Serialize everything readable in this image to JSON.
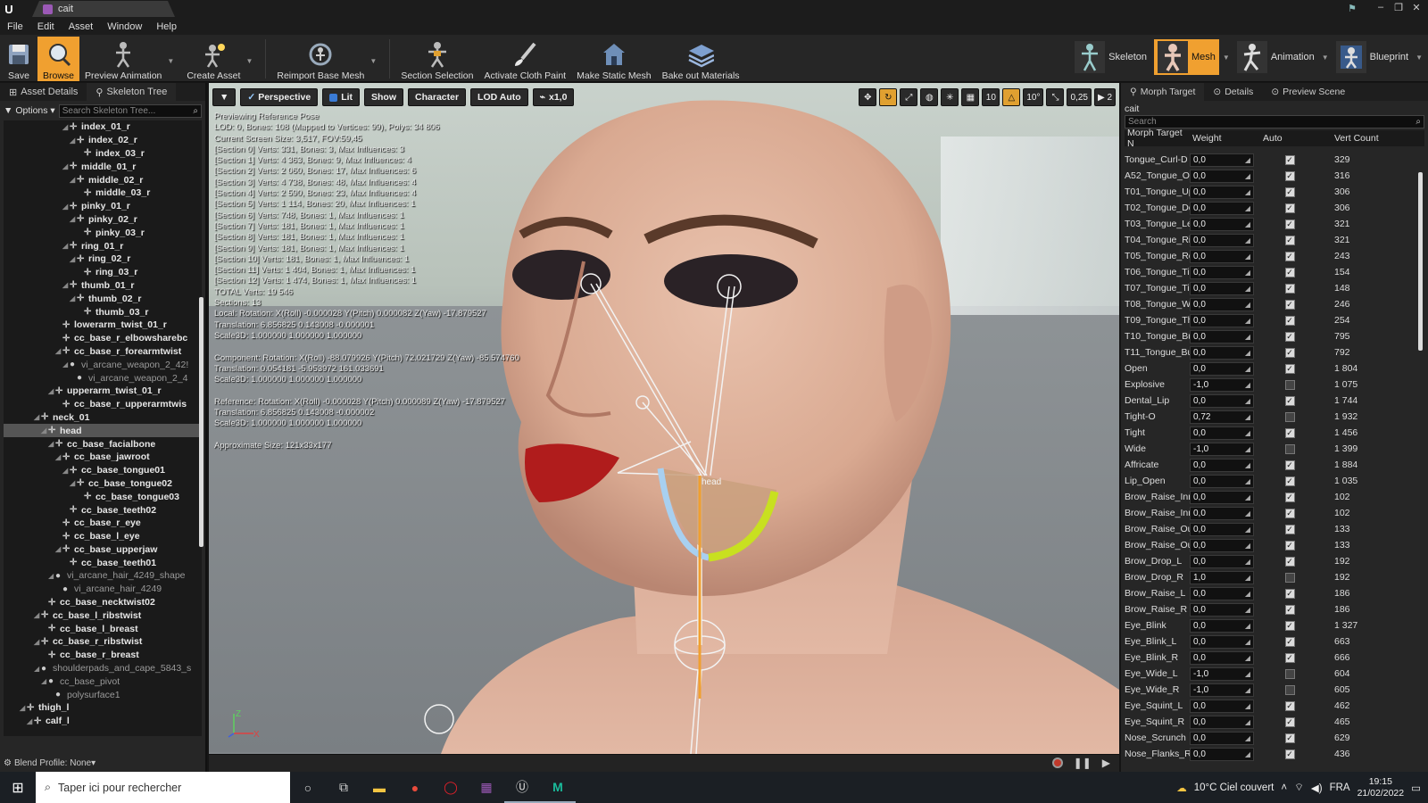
{
  "window": {
    "title": "cait"
  },
  "menu": [
    "File",
    "Edit",
    "Asset",
    "Window",
    "Help"
  ],
  "toolbar": {
    "buttons": [
      "Save",
      "Browse",
      "Preview Animation",
      "Create Asset",
      "Reimport Base Mesh",
      "Section Selection",
      "Activate Cloth Paint",
      "Make Static Mesh",
      "Bake out Materials"
    ],
    "modes": [
      "Skeleton",
      "Mesh",
      "Animation",
      "Blueprint"
    ]
  },
  "left": {
    "tabs": [
      "Asset Details",
      "Skeleton Tree"
    ],
    "options_label": "Options",
    "search_placeholder": "Search Skeleton Tree...",
    "blend_profile": "Blend Profile: None",
    "tree": [
      {
        "label": "index_01_r",
        "depth": 8,
        "dim": false,
        "sel": false,
        "tw": true
      },
      {
        "label": "index_02_r",
        "depth": 9,
        "dim": false,
        "sel": false,
        "tw": true
      },
      {
        "label": "index_03_r",
        "depth": 10,
        "dim": false,
        "sel": false,
        "tw": false
      },
      {
        "label": "middle_01_r",
        "depth": 8,
        "dim": false,
        "sel": false,
        "tw": true
      },
      {
        "label": "middle_02_r",
        "depth": 9,
        "dim": false,
        "sel": false,
        "tw": true
      },
      {
        "label": "middle_03_r",
        "depth": 10,
        "dim": false,
        "sel": false,
        "tw": false
      },
      {
        "label": "pinky_01_r",
        "depth": 8,
        "dim": false,
        "sel": false,
        "tw": true
      },
      {
        "label": "pinky_02_r",
        "depth": 9,
        "dim": false,
        "sel": false,
        "tw": true
      },
      {
        "label": "pinky_03_r",
        "depth": 10,
        "dim": false,
        "sel": false,
        "tw": false
      },
      {
        "label": "ring_01_r",
        "depth": 8,
        "dim": false,
        "sel": false,
        "tw": true
      },
      {
        "label": "ring_02_r",
        "depth": 9,
        "dim": false,
        "sel": false,
        "tw": true
      },
      {
        "label": "ring_03_r",
        "depth": 10,
        "dim": false,
        "sel": false,
        "tw": false
      },
      {
        "label": "thumb_01_r",
        "depth": 8,
        "dim": false,
        "sel": false,
        "tw": true
      },
      {
        "label": "thumb_02_r",
        "depth": 9,
        "dim": false,
        "sel": false,
        "tw": true
      },
      {
        "label": "thumb_03_r",
        "depth": 10,
        "dim": false,
        "sel": false,
        "tw": false
      },
      {
        "label": "lowerarm_twist_01_r",
        "depth": 7,
        "dim": false,
        "sel": false,
        "tw": false
      },
      {
        "label": "cc_base_r_elbowsharebc",
        "depth": 7,
        "dim": false,
        "sel": false,
        "tw": false
      },
      {
        "label": "cc_base_r_forearmtwist",
        "depth": 7,
        "dim": false,
        "sel": false,
        "tw": true
      },
      {
        "label": "vi_arcane_weapon_2_42!",
        "depth": 8,
        "dim": true,
        "sel": false,
        "tw": true
      },
      {
        "label": "vi_arcane_weapon_2_4",
        "depth": 9,
        "dim": true,
        "sel": false,
        "tw": false
      },
      {
        "label": "upperarm_twist_01_r",
        "depth": 6,
        "dim": false,
        "sel": false,
        "tw": true
      },
      {
        "label": "cc_base_r_upperarmtwis",
        "depth": 7,
        "dim": false,
        "sel": false,
        "tw": false
      },
      {
        "label": "neck_01",
        "depth": 4,
        "dim": false,
        "sel": false,
        "tw": true
      },
      {
        "label": "head",
        "depth": 5,
        "dim": false,
        "sel": true,
        "tw": true
      },
      {
        "label": "cc_base_facialbone",
        "depth": 6,
        "dim": false,
        "sel": false,
        "tw": true
      },
      {
        "label": "cc_base_jawroot",
        "depth": 7,
        "dim": false,
        "sel": false,
        "tw": true
      },
      {
        "label": "cc_base_tongue01",
        "depth": 8,
        "dim": false,
        "sel": false,
        "tw": true
      },
      {
        "label": "cc_base_tongue02",
        "depth": 9,
        "dim": false,
        "sel": false,
        "tw": true
      },
      {
        "label": "cc_base_tongue03",
        "depth": 10,
        "dim": false,
        "sel": false,
        "tw": false
      },
      {
        "label": "cc_base_teeth02",
        "depth": 8,
        "dim": false,
        "sel": false,
        "tw": false
      },
      {
        "label": "cc_base_r_eye",
        "depth": 7,
        "dim": false,
        "sel": false,
        "tw": false
      },
      {
        "label": "cc_base_l_eye",
        "depth": 7,
        "dim": false,
        "sel": false,
        "tw": false
      },
      {
        "label": "cc_base_upperjaw",
        "depth": 7,
        "dim": false,
        "sel": false,
        "tw": true
      },
      {
        "label": "cc_base_teeth01",
        "depth": 8,
        "dim": false,
        "sel": false,
        "tw": false
      },
      {
        "label": "vi_arcane_hair_4249_shape",
        "depth": 6,
        "dim": true,
        "sel": false,
        "tw": true
      },
      {
        "label": "vi_arcane_hair_4249",
        "depth": 7,
        "dim": true,
        "sel": false,
        "tw": false
      },
      {
        "label": "cc_base_necktwist02",
        "depth": 5,
        "dim": false,
        "sel": false,
        "tw": false
      },
      {
        "label": "cc_base_l_ribstwist",
        "depth": 4,
        "dim": false,
        "sel": false,
        "tw": true
      },
      {
        "label": "cc_base_l_breast",
        "depth": 5,
        "dim": false,
        "sel": false,
        "tw": false
      },
      {
        "label": "cc_base_r_ribstwist",
        "depth": 4,
        "dim": false,
        "sel": false,
        "tw": true
      },
      {
        "label": "cc_base_r_breast",
        "depth": 5,
        "dim": false,
        "sel": false,
        "tw": false
      },
      {
        "label": "shoulderpads_and_cape_5843_s",
        "depth": 4,
        "dim": true,
        "sel": false,
        "tw": true
      },
      {
        "label": "cc_base_pivot",
        "depth": 5,
        "dim": true,
        "sel": false,
        "tw": true
      },
      {
        "label": "polysurface1",
        "depth": 6,
        "dim": true,
        "sel": false,
        "tw": false
      },
      {
        "label": "thigh_l",
        "depth": 2,
        "dim": false,
        "sel": false,
        "tw": true
      },
      {
        "label": "calf_l",
        "depth": 3,
        "dim": false,
        "sel": false,
        "tw": true
      }
    ]
  },
  "viewport": {
    "buttons": [
      "Perspective",
      "Lit",
      "Show",
      "Character",
      "LOD Auto",
      "x1,0"
    ],
    "right_values": [
      "10",
      "10°",
      "0,25",
      "2"
    ],
    "overlay": [
      "Previewing Reference Pose",
      "LOD: 0, Bones: 108 (Mapped to Vertices: 99), Polys: 34 806",
      "Current Screen Size: 3,517, FOV:59,45",
      "[Section 0] Verts: 331, Bones: 3, Max Influences: 3",
      "[Section 1] Verts: 4 363, Bones: 9, Max Influences: 4",
      "[Section 2] Verts: 2 060, Bones: 17, Max Influences: 6",
      "[Section 3] Verts: 4 738, Bones: 48, Max Influences: 4",
      "[Section 4] Verts: 2 590, Bones: 23, Max Influences: 4",
      "[Section 5] Verts: 1 114, Bones: 20, Max Influences: 1",
      "[Section 6] Verts: 748, Bones: 1, Max Influences: 1",
      "[Section 7] Verts: 181, Bones: 1, Max Influences: 1",
      "[Section 8] Verts: 181, Bones: 1, Max Influences: 1",
      "[Section 9] Verts: 181, Bones: 1, Max Influences: 1",
      "[Section 10] Verts: 181, Bones: 1, Max Influences: 1",
      "[Section 11] Verts: 1 404, Bones: 1, Max Influences: 1",
      "[Section 12] Verts: 1 474, Bones: 1, Max Influences: 1",
      "TOTAL Verts: 19 546",
      "Sections: 13",
      "Local: Rotation: X(Roll) -0.000028 Y(Pitch) 0.000082 Z(Yaw) -17.879527",
      "Translation: 6.856825 0.143008 -0.000001",
      "Scale3D: 1.000000 1.000000 1.000000",
      "",
      "Component: Rotation: X(Roll) -88.079926 Y(Pitch) 72.021729 Z(Yaw) -85.574760",
      "Translation: 0.054181 -5.953972 161.033691",
      "Scale3D: 1.000000 1.000000 1.000000",
      "",
      "Reference: Rotation: X(Roll) -0.000028 Y(Pitch) 0.000089 Z(Yaw) -17.879527",
      "Translation: 6.856825 0.143008 -0.000002",
      "Scale3D: 1.000000 1.000000 1.000000",
      "",
      "Approximate Size: 121x33x177"
    ],
    "bone_label": "head",
    "axis_z": "Z",
    "axis_x": "X"
  },
  "right": {
    "tabs": [
      "Morph Target",
      "Details",
      "Preview Scene"
    ],
    "asset_name": "cait",
    "search_placeholder": "Search",
    "headers": [
      "Morph Target N",
      "Weight",
      "Auto",
      "Vert Count"
    ],
    "rows": [
      {
        "name": "Tongue_Curl-D",
        "weight": "0,0",
        "auto": true,
        "count": "329"
      },
      {
        "name": "A52_Tongue_Ou",
        "weight": "0,0",
        "auto": true,
        "count": "316"
      },
      {
        "name": "T01_Tongue_Up",
        "weight": "0,0",
        "auto": true,
        "count": "306"
      },
      {
        "name": "T02_Tongue_Do",
        "weight": "0,0",
        "auto": true,
        "count": "306"
      },
      {
        "name": "T03_Tongue_Le",
        "weight": "0,0",
        "auto": true,
        "count": "321"
      },
      {
        "name": "T04_Tongue_Ric",
        "weight": "0,0",
        "auto": true,
        "count": "321"
      },
      {
        "name": "T05_Tongue_Ro",
        "weight": "0,0",
        "auto": true,
        "count": "243"
      },
      {
        "name": "T06_Tongue_Tip",
        "weight": "0,0",
        "auto": true,
        "count": "154"
      },
      {
        "name": "T07_Tongue_Tip",
        "weight": "0,0",
        "auto": true,
        "count": "148"
      },
      {
        "name": "T08_Tongue_Wi",
        "weight": "0,0",
        "auto": true,
        "count": "246"
      },
      {
        "name": "T09_Tongue_Th",
        "weight": "0,0",
        "auto": true,
        "count": "254"
      },
      {
        "name": "T10_Tongue_Bu",
        "weight": "0,0",
        "auto": true,
        "count": "795"
      },
      {
        "name": "T11_Tongue_Bu",
        "weight": "0,0",
        "auto": true,
        "count": "792"
      },
      {
        "name": "Open",
        "weight": "0,0",
        "auto": true,
        "count": "1 804"
      },
      {
        "name": "Explosive",
        "weight": "-1,0",
        "auto": false,
        "count": "1 075"
      },
      {
        "name": "Dental_Lip",
        "weight": "0,0",
        "auto": true,
        "count": "1 744"
      },
      {
        "name": "Tight-O",
        "weight": "0,72",
        "auto": false,
        "count": "1 932"
      },
      {
        "name": "Tight",
        "weight": "0,0",
        "auto": true,
        "count": "1 456"
      },
      {
        "name": "Wide",
        "weight": "-1,0",
        "auto": false,
        "count": "1 399"
      },
      {
        "name": "Affricate",
        "weight": "0,0",
        "auto": true,
        "count": "1 884"
      },
      {
        "name": "Lip_Open",
        "weight": "0,0",
        "auto": true,
        "count": "1 035"
      },
      {
        "name": "Brow_Raise_Inn",
        "weight": "0,0",
        "auto": true,
        "count": "102"
      },
      {
        "name": "Brow_Raise_Inn",
        "weight": "0,0",
        "auto": true,
        "count": "102"
      },
      {
        "name": "Brow_Raise_Out",
        "weight": "0,0",
        "auto": true,
        "count": "133"
      },
      {
        "name": "Brow_Raise_Out",
        "weight": "0,0",
        "auto": true,
        "count": "133"
      },
      {
        "name": "Brow_Drop_L",
        "weight": "0,0",
        "auto": true,
        "count": "192"
      },
      {
        "name": "Brow_Drop_R",
        "weight": "1,0",
        "auto": false,
        "count": "192"
      },
      {
        "name": "Brow_Raise_L",
        "weight": "0,0",
        "auto": true,
        "count": "186"
      },
      {
        "name": "Brow_Raise_R",
        "weight": "0,0",
        "auto": true,
        "count": "186"
      },
      {
        "name": "Eye_Blink",
        "weight": "0,0",
        "auto": true,
        "count": "1 327"
      },
      {
        "name": "Eye_Blink_L",
        "weight": "0,0",
        "auto": true,
        "count": "663"
      },
      {
        "name": "Eye_Blink_R",
        "weight": "0,0",
        "auto": true,
        "count": "666"
      },
      {
        "name": "Eye_Wide_L",
        "weight": "-1,0",
        "auto": false,
        "count": "604"
      },
      {
        "name": "Eye_Wide_R",
        "weight": "-1,0",
        "auto": false,
        "count": "605"
      },
      {
        "name": "Eye_Squint_L",
        "weight": "0,0",
        "auto": true,
        "count": "462"
      },
      {
        "name": "Eye_Squint_R",
        "weight": "0,0",
        "auto": true,
        "count": "465"
      },
      {
        "name": "Nose_Scrunch",
        "weight": "0,0",
        "auto": true,
        "count": "629"
      },
      {
        "name": "Nose_Flanks_Ra",
        "weight": "0,0",
        "auto": true,
        "count": "436"
      }
    ]
  },
  "taskbar": {
    "search_placeholder": "Taper ici pour rechercher",
    "weather": "10°C  Ciel couvert",
    "lang": "FRA",
    "time": "19:15",
    "date": "21/02/2022"
  },
  "colors": {
    "accent": "#f0a030",
    "panel": "#262626",
    "selection": "#555555"
  }
}
